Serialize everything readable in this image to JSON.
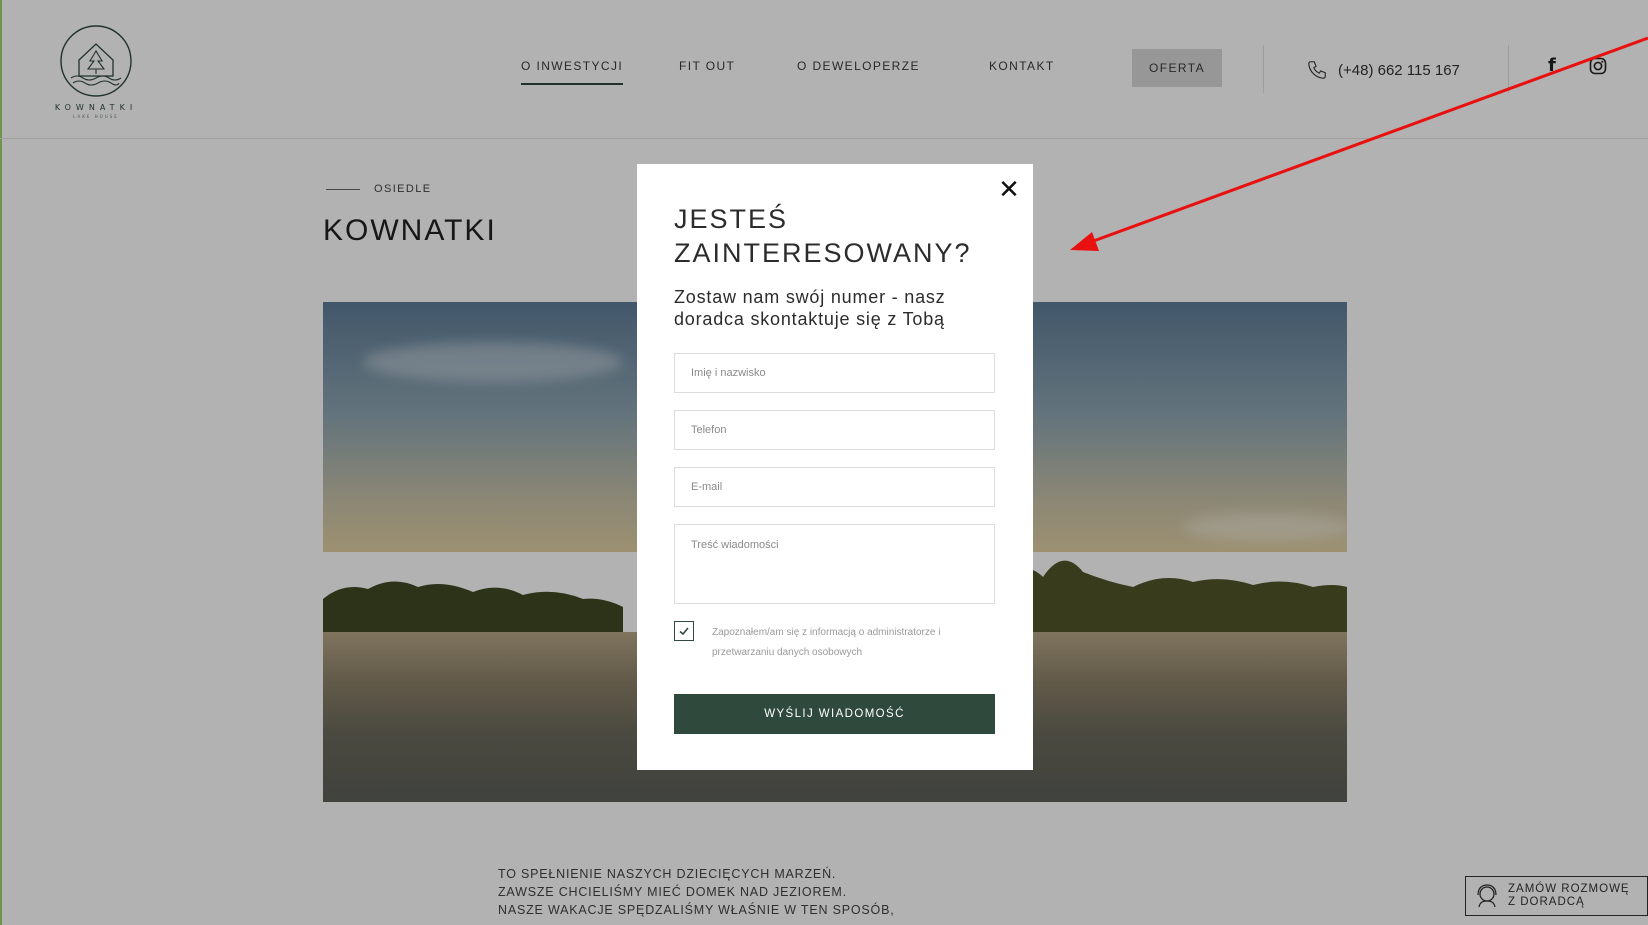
{
  "brand": {
    "name": "KOWNATKI",
    "tagline": "LAKE HOUSE"
  },
  "nav": {
    "items": [
      "O INWESTYCJI",
      "FIT OUT",
      "O DEWELOPERZE",
      "KONTAKT"
    ],
    "offer_label": "OFERTA",
    "phone": "(+48) 662 115 167",
    "facebook_glyph": "f"
  },
  "page": {
    "breadcrumb": "OSIEDLE",
    "title": "KOWNATKI",
    "body_lines": [
      "TO SPEŁNIENIE NASZYCH DZIECIĘCYCH MARZEŃ.",
      "ZAWSZE CHCIELIŚMY MIEĆ DOMEK NAD JEZIOREM.",
      "NASZE WAKACJE SPĘDZALIŚMY WŁAŚNIE W TEN SPOSÓB,"
    ],
    "consult_line1": "ZAMÓW ROZMOWĘ",
    "consult_line2": "Z DORADCĄ"
  },
  "modal": {
    "close_glyph": "✕",
    "title": "JESTEŚ ZAINTERESOWANY?",
    "subtitle": "Zostaw nam swój numer - nasz doradca skontaktuje się z Tobą",
    "fields": {
      "name_placeholder": "Imię i nazwisko",
      "phone_placeholder": "Telefon",
      "email_placeholder": "E-mail",
      "message_placeholder": "Treść wiadomości"
    },
    "consent_checked": true,
    "consent_text": "Zapoznałem/am się z informacją o administratorze i przetwarzaniu danych osobowych",
    "submit_label": "WYŚLIJ WIADOMOŚĆ"
  },
  "colors": {
    "accent": "#2f4a3d",
    "overlay": "rgba(0,0,0,0.30)",
    "annotation_arrow": "#e8110f"
  },
  "icons": {
    "phone": "phone-icon",
    "facebook": "facebook-icon",
    "instagram": "instagram-icon",
    "close": "close-icon",
    "consult": "headset-icon",
    "check": "check-icon"
  }
}
